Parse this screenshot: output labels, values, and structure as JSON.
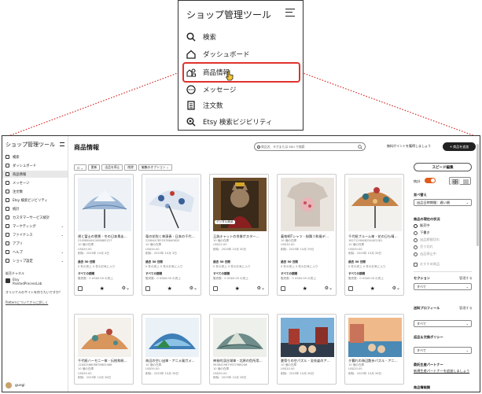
{
  "zoom": {
    "title": "ショップ管理ツール",
    "items": [
      {
        "label": "検索",
        "icon": "search-icon"
      },
      {
        "label": "ダッシュボード",
        "icon": "home-icon"
      },
      {
        "label": "商品情報",
        "icon": "listings-icon"
      },
      {
        "label": "メッセージ",
        "icon": "message-icon"
      },
      {
        "label": "注文数",
        "icon": "orders-icon"
      },
      {
        "label": "Etsy 検索ビジビリティ",
        "icon": "search-visibility-icon"
      }
    ]
  },
  "sidebar": {
    "title": "ショップ管理ツール",
    "items": [
      {
        "label": "検索"
      },
      {
        "label": "ダッシュボード"
      },
      {
        "label": "商品情報"
      },
      {
        "label": "メッセージ"
      },
      {
        "label": "注文数"
      },
      {
        "label": "Etsy 検索ビジビリティ"
      },
      {
        "label": "統計"
      },
      {
        "label": "カスタマーサービス統計"
      },
      {
        "label": "マーケティング"
      },
      {
        "label": "ファイナンス"
      },
      {
        "label": "アプリ"
      },
      {
        "label": "ヘルプ"
      },
      {
        "label": "ショップ設定"
      }
    ],
    "channels_label": "販売チャネル",
    "etsy_name": "Etsy",
    "etsy_shop": "PaintedProcessLab",
    "promo_1": "オリジナルのサイトを作りたいですか？",
    "promo_2": "Patternについてさらに詳しく",
    "user": "gungi"
  },
  "main": {
    "title": "商品情報",
    "search_placeholder": "商品名、タグまたは SKU で検索",
    "free_points": "無料ポイントを獲得しましょう",
    "add_button": "+ 商品を追加",
    "toolbar": [
      "更新",
      "出品を停止",
      "削除",
      "編集のオプション ⌄"
    ],
    "cards": [
      {
        "title": "帰と富士の雲景 - 冬の日本景走…",
        "sku": "2345864442408885227",
        "stock": "10 個の在庫",
        "price": "US$50.00",
        "date": "削除：2025年 10月 4日",
        "sales": "過去 30 日間",
        "fav": "0 件の売上 0 件のお気に入り",
        "renew": "すべての期間",
        "sold": "販売数：0 US$0.00 の売上"
      },
      {
        "title": "竜の花吹く傘演奏 - 日本の千代…",
        "sku": "2280447825376840820",
        "stock": "10 個の在庫",
        "price": "US$50.00",
        "date": "削除：2025年 10月 3日",
        "sales": "過去 30 日間",
        "fav": "0 件の売上 0 件のお気に入り",
        "renew": "すべての期間",
        "sold": "販売数：0 US$0.00 の売上"
      },
      {
        "title": "王族キャットの肖像ポスター…",
        "sku": "",
        "stock": "10 個の在庫",
        "price": "US$22.00",
        "date": "削除：2025年 10月 30日",
        "sales": "過去 30 日間",
        "fav": "0 件の売上 0 件のお気に入り",
        "renew": "すべての期間",
        "sold": "販売数：0 US$0.00 の売上",
        "tag": "デジタル商品"
      },
      {
        "title": "着物柄Tシャツ - 桜舞う和風デ…",
        "sku": "",
        "stock": "10 個の在庫",
        "price": "US$30.00",
        "date": "削除：2025年 10月 29日",
        "sales": "過去 30 日間",
        "fav": "0 件の売上 0 件のお気に入り",
        "renew": "すべての期間",
        "sold": "販売数：0 US$0.00 の売上"
      },
      {
        "title": "千代紙ブルーム傘 - 花の日も晴…",
        "sku": "1827129068234402281",
        "stock": "10 個の在庫",
        "price": "US$50.00",
        "date": "削除：2025年 10月 28日",
        "sales": "過去 30 日間",
        "fav": "0 件の売上 0 件のお気に入り",
        "renew": "すべての期間",
        "sold": "販売数：0 US$0.00 の売上"
      }
    ],
    "cards2": [
      {
        "title": "千代紙ハーモニー傘 - 伝統和紙…",
        "sku": "1284258808878805468",
        "stock": "10 個の在庫",
        "price": "US$50.00",
        "date": "削除：2025年 10月 28日"
      },
      {
        "title": "海辺の空い出傘 - アニメ風ガメ…",
        "sku": "",
        "stock": "10 個の在庫",
        "price": "US$50.00",
        "date": "削除：2025年 10月 28日"
      },
      {
        "title": "神秘的渓谷湖傘 - 北原の危所用…",
        "sku": "9836429879537986246",
        "stock": "10 個の在庫",
        "price": "US$50.00",
        "date": "削除：2025年 10月 28日"
      },
      {
        "title": "夏祭りの空パズル - 浴衣姿のア…",
        "sku": "",
        "stock": "10 個の在庫",
        "price": "US$20.00",
        "date": "削除：2025年 10月 28日"
      },
      {
        "title": "夕暮れの海辺散歩パズル - アニ…",
        "sku": "",
        "stock": "10 個の在庫",
        "price": "US$20.00",
        "date": "削除：2025年 10月 28日"
      }
    ]
  },
  "right": {
    "speed_edit": "スピード編集",
    "stats": "統計",
    "sort_label": "並べ替え",
    "sort_value": "出品日時期間：遅い順",
    "status_label": "商品の現在の状況",
    "statuses": [
      "販売中",
      "下書き",
      "出品期限切れ",
      "売り切れ",
      "出品停止中"
    ],
    "featured": "おすすめ商品",
    "section_label": "セクション",
    "section_value": "すべて",
    "shipping_label": "送料プロフィール",
    "shipping_value": "すべて",
    "return_label": "返品＆交換ポリシー",
    "return_value": "すべて",
    "partner_label": "委託生産パートナー",
    "partner_link": "新規生産パートナーを追加しましょう",
    "manage": "管理する",
    "product_type": "商品情報類"
  }
}
